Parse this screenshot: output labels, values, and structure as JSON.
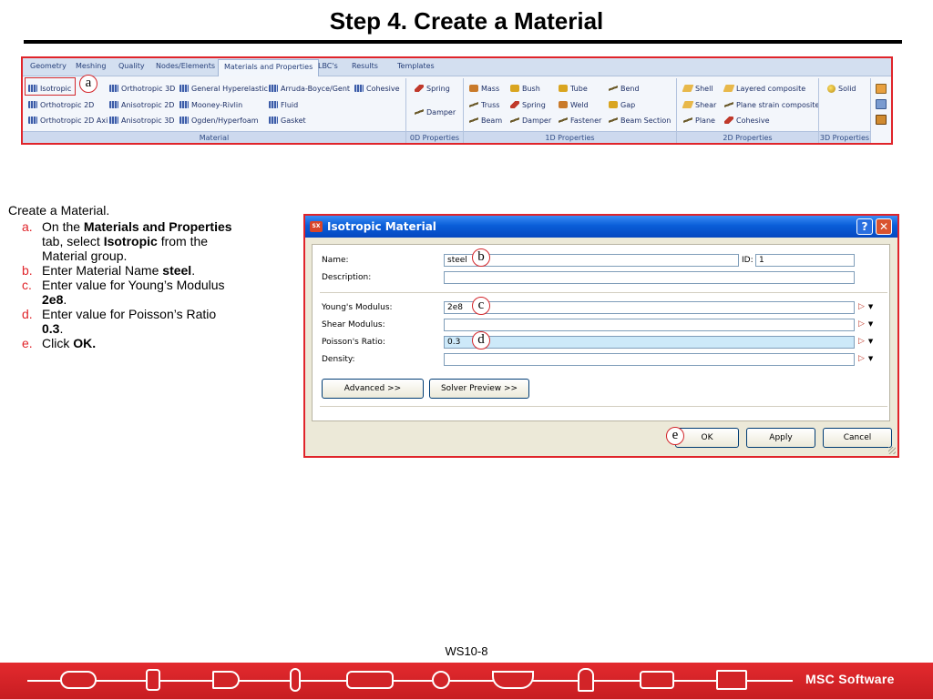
{
  "slide": {
    "title": "Step 4. Create a Material",
    "footer_label": "WS10-8",
    "brand": "MSC Software"
  },
  "ribbon": {
    "tabs": [
      "Geometry",
      "Meshing",
      "Quality",
      "Nodes/Elements",
      "Materials and Properties",
      "LBC's",
      "Results",
      "Templates"
    ],
    "active_tab": "Materials and Properties",
    "material": {
      "col1": [
        "Isotropic",
        "Orthotropic 2D",
        "Orthotropic 2D Axi"
      ],
      "col2": [
        "Orthotropic 3D",
        "Anisotropic 2D",
        "Anisotropic 3D"
      ],
      "col3": [
        "General Hyperelastic",
        "Mooney-Rivlin",
        "Ogden/Hyperfoam"
      ],
      "col4": [
        "Arruda-Boyce/Gent",
        "Fluid",
        "Gasket"
      ],
      "col5": [
        "Cohesive"
      ],
      "group": "Material"
    },
    "zero_d": {
      "items": [
        "Spring",
        "Damper"
      ],
      "group": "0D Properties"
    },
    "one_d": {
      "col1": [
        "Mass",
        "Truss",
        "Beam"
      ],
      "col2": [
        "Bush",
        "Spring",
        "Damper"
      ],
      "col3": [
        "Tube",
        "Weld",
        "Fastener"
      ],
      "col4": [
        "Bend",
        "Gap",
        "Beam Section"
      ],
      "group": "1D Properties"
    },
    "two_d": {
      "col1": [
        "Shell",
        "Shear",
        "Plane"
      ],
      "col2": [
        "Layered composite",
        "Plane strain composite",
        "Cohesive"
      ],
      "group": "2D Properties"
    },
    "three_d": {
      "items": [
        "Solid"
      ],
      "group": "3D Properties"
    }
  },
  "instructions": {
    "heading": "Create a Material.",
    "steps": [
      {
        "letter": "a.",
        "pre": "On the ",
        "b1": "Materials and Properties",
        "mid": " tab, select ",
        "b2": "Isotropic",
        "post": " from the Material group."
      },
      {
        "letter": "b.",
        "pre": "Enter Material Name ",
        "b1": "steel",
        "post": "."
      },
      {
        "letter": "c.",
        "pre": "Enter value for Young’s Modulus ",
        "b1": "2e8",
        "post": "."
      },
      {
        "letter": "d.",
        "pre": "Enter value for Poisson’s Ratio ",
        "b1": "0.3",
        "post": "."
      },
      {
        "letter": "e.",
        "pre": "Click ",
        "b1": "OK.",
        "post": ""
      }
    ]
  },
  "callouts": {
    "a": "a",
    "b": "b",
    "c": "c",
    "d": "d",
    "e": "e"
  },
  "dialog": {
    "title": "Isotropic Material",
    "app_icon": "SX",
    "help": "?",
    "close": "✕",
    "name_label": "Name:",
    "name_value": "steel",
    "id_label": "ID:",
    "id_value": "1",
    "description_label": "Description:",
    "description_value": "",
    "youngs_label": "Young's Modulus:",
    "youngs_value": "2e8",
    "shear_label": "Shear Modulus:",
    "shear_value": "",
    "poisson_label": "Poisson's Ratio:",
    "poisson_value": "0.3",
    "density_label": "Density:",
    "density_value": "",
    "advanced": "Advanced >>",
    "solver_preview": "Solver Preview >>",
    "ok": "OK",
    "apply": "Apply",
    "cancel": "Cancel"
  },
  "colors": {
    "accent": "#e0242a",
    "titlebar": "#0a5ed8",
    "highlight_field": "#cde9f9"
  }
}
